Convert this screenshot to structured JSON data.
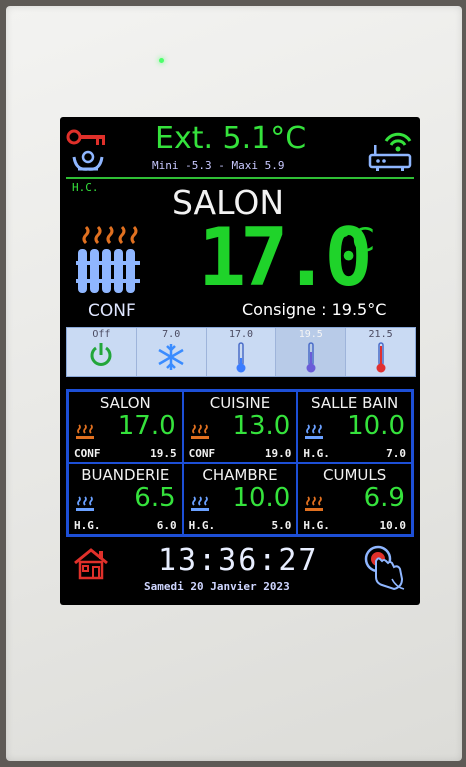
{
  "header": {
    "ext_temp": "Ext. 5.1°C",
    "min_max": "Mini -5.3 - Maxi 5.9",
    "mode_code": "H.C."
  },
  "main": {
    "room_name": "SALON",
    "temperature": "17.0",
    "unit": "°C",
    "mode": "CONF",
    "setpoint": "Consigne : 19.5°C"
  },
  "strip": [
    {
      "label": "Off",
      "icon": "power-icon"
    },
    {
      "label": "7.0",
      "icon": "snowflake-icon"
    },
    {
      "label": "17.0",
      "icon": "thermometer-low-icon"
    },
    {
      "label": "19.5",
      "icon": "thermometer-mid-icon"
    },
    {
      "label": "21.5",
      "icon": "thermometer-high-icon"
    }
  ],
  "rooms": [
    {
      "name": "SALON",
      "temp": "17.0",
      "mode": "CONF",
      "setpoint": "19.5",
      "heating": true
    },
    {
      "name": "CUISINE",
      "temp": "13.0",
      "mode": "CONF",
      "setpoint": "19.0",
      "heating": true
    },
    {
      "name": "SALLE BAIN",
      "temp": "10.0",
      "mode": "H.G.",
      "setpoint": "7.0",
      "heating": false
    },
    {
      "name": "BUANDERIE",
      "temp": "6.5",
      "mode": "H.G.",
      "setpoint": "6.0",
      "heating": false
    },
    {
      "name": "CHAMBRE",
      "temp": "10.0",
      "mode": "H.G.",
      "setpoint": "5.0",
      "heating": false
    },
    {
      "name": "CUMULS",
      "temp": "6.9",
      "mode": "H.G.",
      "setpoint": "10.0",
      "heating": true
    }
  ],
  "footer": {
    "time": "13:36:27",
    "date": "Samedi 20 Janvier 2023"
  },
  "colors": {
    "green": "#35e23c",
    "heat_active": "#e07020",
    "heat_idle": "#6aa0ff",
    "border": "#1d4fd6"
  }
}
